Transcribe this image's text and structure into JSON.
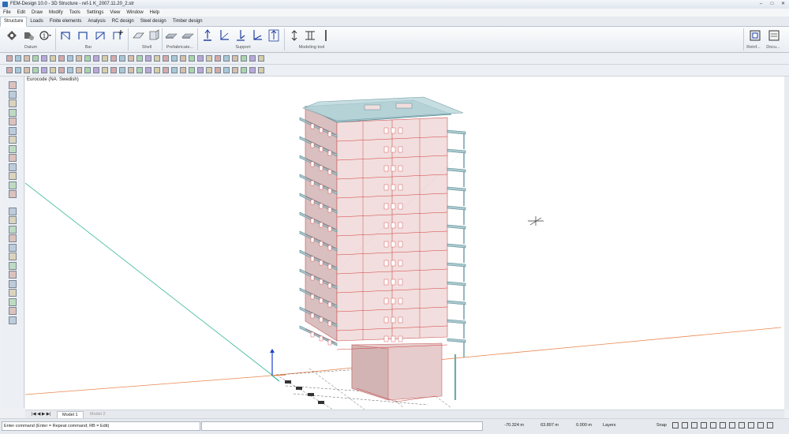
{
  "window": {
    "title": "FEM-Design 10.0 - 3D Structure - ref-1 K_2007.11.20_2.str"
  },
  "menu": [
    "File",
    "Edit",
    "Draw",
    "Modify",
    "Tools",
    "Settings",
    "View",
    "Window",
    "Help"
  ],
  "tabs": [
    "Structure",
    "Loads",
    "Finite elements",
    "Analysis",
    "RC design",
    "Steel design",
    "Timber design"
  ],
  "ribbon_groups": {
    "datum": "Datum",
    "bar": "Bar",
    "shell": "Shell",
    "prefab": "Prefabricate...",
    "support": "Support",
    "modeling": "Modeling tool",
    "reinf": "Reinf...",
    "docu": "Docu..."
  },
  "canvas": {
    "code_label": "Eurocode (NA: Swedish)"
  },
  "model_tabs": [
    "Model 1",
    "Model 2"
  ],
  "status": {
    "command": "Enter command (Enter = Repeat command; RB = Edit)",
    "x": "-70.324 m",
    "y": "63.897 m",
    "z": "0.000 m",
    "layers": "Layers",
    "snap": "Snap"
  },
  "colors": {
    "slab": "#a9c9cf",
    "wall": "#f2dede",
    "edge": "#d23a3a",
    "axis_x": "#e8864f",
    "axis_y": "#39b89b",
    "axis_z": "#1a3fd0"
  }
}
